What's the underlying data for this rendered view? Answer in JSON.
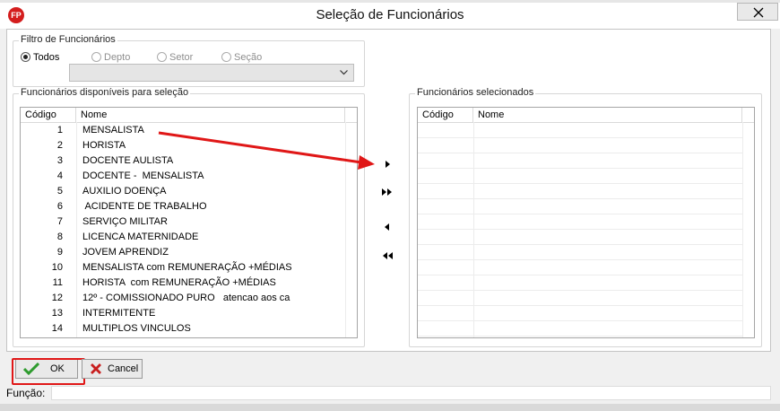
{
  "window": {
    "title": "Seleção de Funcionários",
    "app_icon_text": "FP",
    "close_icon": "close-x-icon"
  },
  "filter": {
    "legend": "Filtro de Funcionários",
    "options": [
      {
        "label": "Todos",
        "checked": true,
        "enabled": true
      },
      {
        "label": "Depto",
        "checked": false,
        "enabled": false
      },
      {
        "label": "Setor",
        "checked": false,
        "enabled": false
      },
      {
        "label": "Seção",
        "checked": false,
        "enabled": false
      }
    ],
    "combo_value": ""
  },
  "available": {
    "legend": "Funcionários disponíveis para seleção",
    "columns": [
      "Código",
      "Nome"
    ],
    "rows": [
      {
        "code": "1",
        "name": "MENSALISTA"
      },
      {
        "code": "2",
        "name": "HORISTA"
      },
      {
        "code": "3",
        "name": "DOCENTE AULISTA"
      },
      {
        "code": "4",
        "name": "DOCENTE -  MENSALISTA"
      },
      {
        "code": "5",
        "name": "AUXILIO DOENÇA"
      },
      {
        "code": "6",
        "name": " ACIDENTE DE TRABALHO"
      },
      {
        "code": "7",
        "name": "SERVIÇO MILITAR"
      },
      {
        "code": "8",
        "name": "LICENCA MATERNIDADE"
      },
      {
        "code": "9",
        "name": "JOVEM APRENDIZ"
      },
      {
        "code": "10",
        "name": "MENSALISTA com REMUNERAÇÃO +MÉDIAS"
      },
      {
        "code": "11",
        "name": "HORISTA  com REMUNERAÇÃO +MÉDIAS"
      },
      {
        "code": "12",
        "name": "12º - COMISSIONADO PURO   atencao aos ca"
      },
      {
        "code": "13",
        "name": "INTERMITENTE"
      },
      {
        "code": "14",
        "name": "MULTIPLOS VINCULOS"
      }
    ]
  },
  "selected": {
    "legend": "Funcionários selecionados",
    "columns": [
      "Código",
      "Nome"
    ],
    "rows": []
  },
  "move_buttons": [
    {
      "name": "move-one-right-button",
      "icon": "single-arrow-right-icon"
    },
    {
      "name": "move-all-right-button",
      "icon": "double-arrow-right-icon"
    },
    {
      "name": "move-one-left-button",
      "icon": "single-arrow-left-icon"
    },
    {
      "name": "move-all-left-button",
      "icon": "double-arrow-left-icon"
    }
  ],
  "buttons": {
    "ok_label": "OK",
    "cancel_label": "Cancel"
  },
  "status": {
    "label": "Função:",
    "value": ""
  },
  "colors": {
    "annotation_red": "#e01717",
    "ok_check_green": "#2e9b2e",
    "cancel_x_red": "#c81e1e",
    "app_icon_red": "#d41d1d"
  }
}
